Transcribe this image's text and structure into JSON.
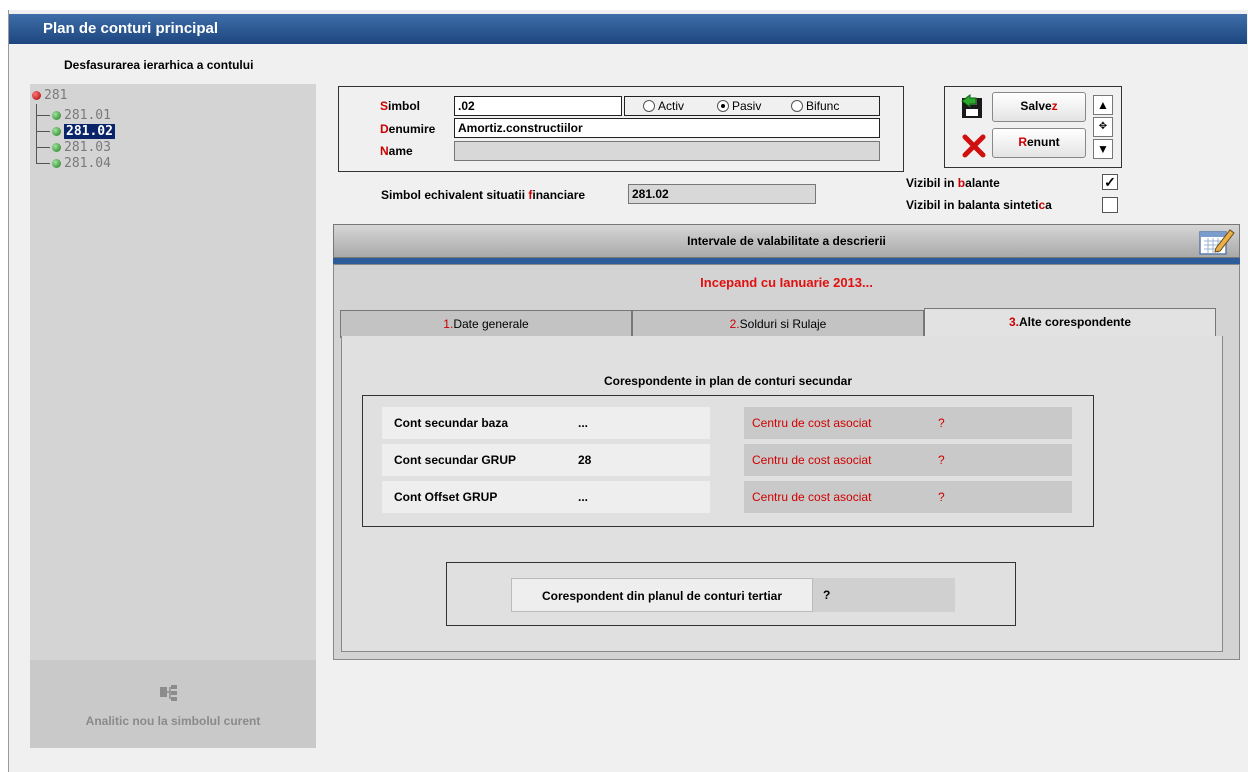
{
  "window": {
    "title": "Plan de conturi principal"
  },
  "hierarchy": {
    "label": "Desfasurarea ierarhica a contului",
    "root": "281",
    "children": [
      "281.01",
      "281.02",
      "281.03",
      "281.04"
    ],
    "selected": "281.02",
    "new_analytic_label": "Analitic nou la simbolul curent"
  },
  "form": {
    "simbol_label_hot": "S",
    "simbol_label_rest": "imbol",
    "simbol_value": ".02",
    "denumire_label_hot": "D",
    "denumire_label_rest": "enumire",
    "denumire_value": "Amortiz.constructiilor",
    "name_label_hot": "N",
    "name_label_rest": "ame",
    "name_value": "",
    "type_options": [
      "Activ",
      "Pasiv",
      "Bifunc"
    ],
    "type_selected": "Pasiv",
    "echivalent_label_a": "Simbol echivalent situatii ",
    "echivalent_label_hot": "f",
    "echivalent_label_b": "inanciare",
    "echivalent_value": "281.02"
  },
  "buttons": {
    "save_a": "Salve",
    "save_hot": "z",
    "cancel_hot": "R",
    "cancel_b": "enunt"
  },
  "visibility": {
    "balante_a": "Vizibil in ",
    "balante_hot": "b",
    "balante_b": "alante",
    "balante_checked": true,
    "sintetica_a": "Vizibil in balanta sinteti",
    "sintetica_hot": "c",
    "sintetica_b": "a",
    "sintetica_checked": false
  },
  "intervals": {
    "title": "Intervale de valabilitate a descrierii",
    "current": "Incepand cu Ianuarie 2013..."
  },
  "tabs": [
    {
      "num": "1.",
      "label": "Date generale",
      "active": false
    },
    {
      "num": "2.",
      "label": "Solduri si Rulaje",
      "active": false
    },
    {
      "num": "3.",
      "label": "Alte corespondente",
      "active": true
    }
  ],
  "correspondences": {
    "title": "Corespondente in plan de conturi secundar",
    "rows": [
      {
        "label": "Cont secundar baza",
        "value": "...",
        "cost_label": "Centru de cost asociat",
        "cost_value": "?"
      },
      {
        "label": "Cont secundar GRUP",
        "value": "28",
        "cost_label": "Centru de cost asociat",
        "cost_value": "?"
      },
      {
        "label": "Cont Offset GRUP",
        "value": "...",
        "cost_label": "Centru de cost asociat",
        "cost_value": "?"
      }
    ],
    "tertiar_label": "Corespondent din planul de conturi tertiar",
    "tertiar_value": "?"
  },
  "colors": {
    "title_bar": "#1d4680",
    "hotkey": "#cc0000",
    "selection": "#0a246a"
  }
}
